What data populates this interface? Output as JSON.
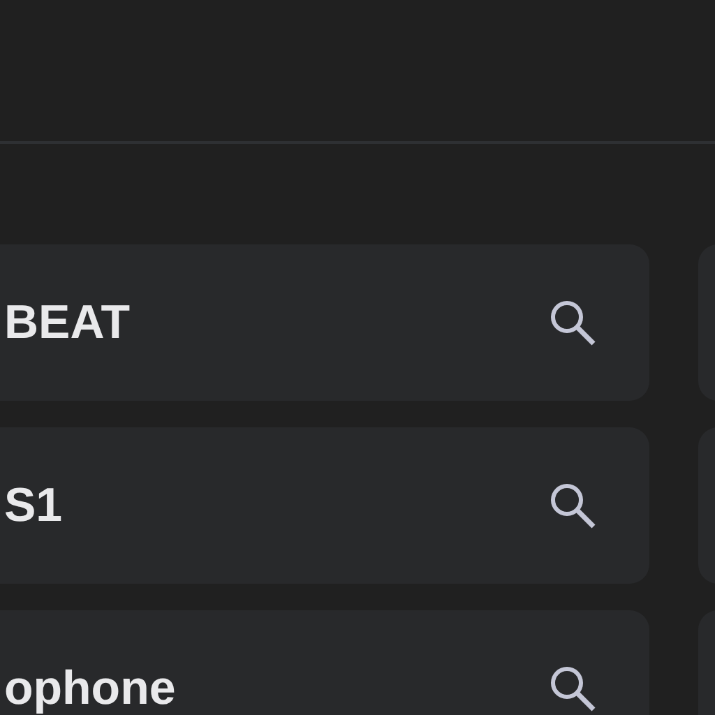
{
  "items": [
    {
      "title": "BEAT"
    },
    {
      "title": "S1"
    },
    {
      "title": "ophone"
    }
  ]
}
